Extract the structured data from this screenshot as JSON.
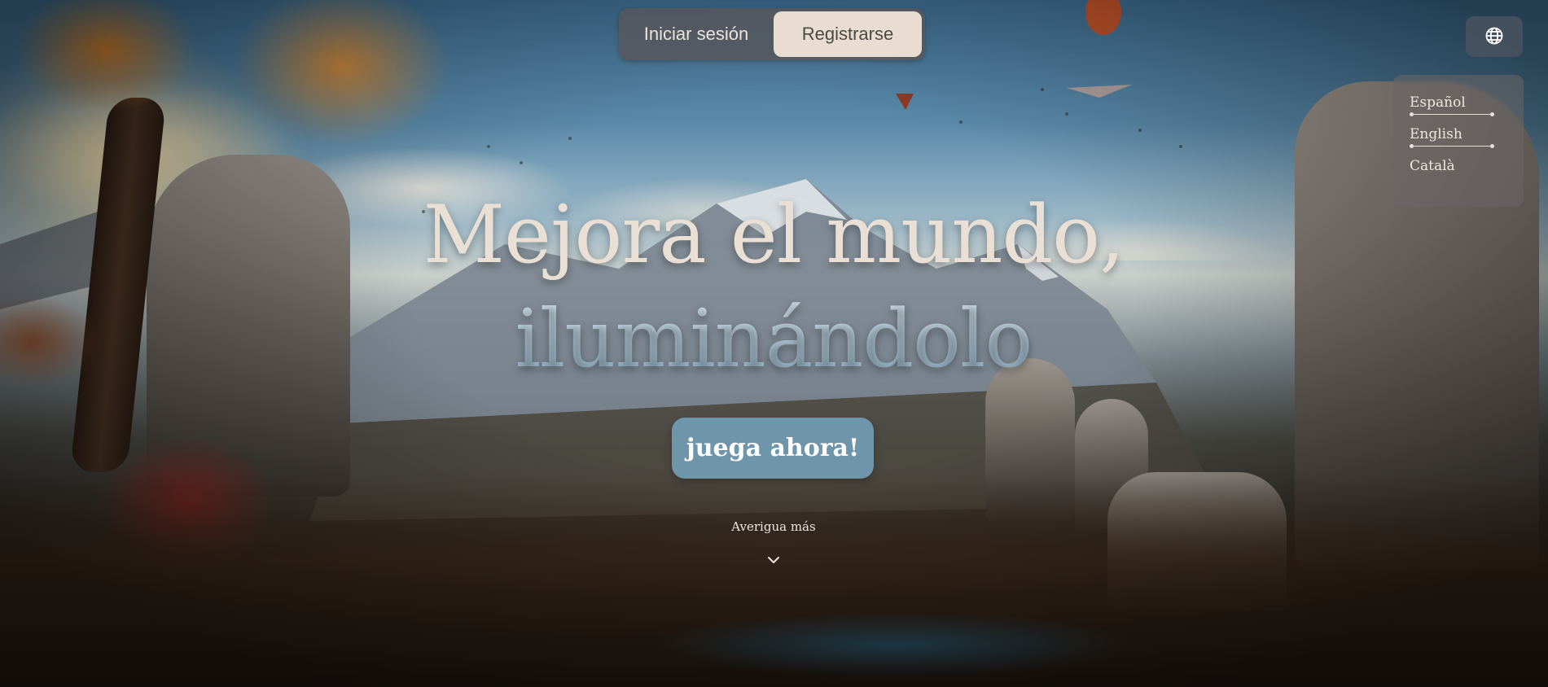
{
  "auth": {
    "login_label": "Iniciar sesión",
    "register_label": "Registrarse",
    "active": "register"
  },
  "language": {
    "toggle_icon": "globe-icon",
    "options": [
      {
        "label": "Español"
      },
      {
        "label": "English"
      },
      {
        "label": "Català"
      }
    ]
  },
  "hero": {
    "headline_line1": "Mejora el mundo,",
    "headline_line2": "iluminándolo",
    "cta_label": "juega ahora!",
    "learn_more_label": "Averigua más",
    "learn_more_icon": "chevron-down-icon"
  },
  "colors": {
    "accent": "#6f95ab",
    "active_tab_bg": "#e9ddd1",
    "headline_primary": "#eadfd4",
    "headline_secondary": "#9fbdd0"
  }
}
